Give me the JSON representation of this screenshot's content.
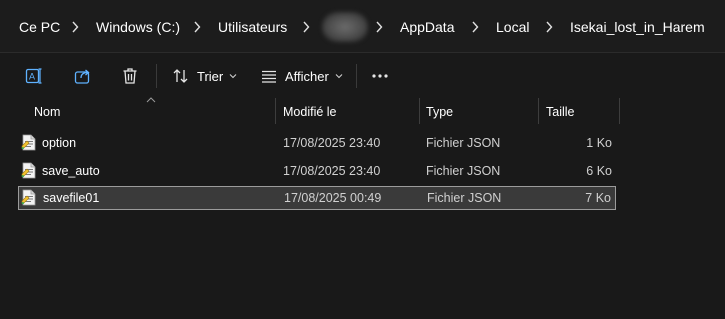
{
  "breadcrumb": {
    "items": [
      "Ce PC",
      "Windows (C:)",
      "Utilisateurs",
      "AppData",
      "Local",
      "Isekai_lost_in_Harem"
    ],
    "hidden_item_note": ""
  },
  "toolbar": {
    "rename_icon": "rename-icon",
    "share_icon": "share-icon",
    "delete_icon": "delete-icon",
    "sort_label": "Trier",
    "view_label": "Afficher",
    "more_icon": "more-icon"
  },
  "columns": {
    "name": "Nom",
    "modified": "Modifié le",
    "type": "Type",
    "size": "Taille"
  },
  "files": [
    {
      "name": "option",
      "modified": "17/08/2025 23:40",
      "type": "Fichier JSON",
      "size": "1 Ko",
      "selected": false
    },
    {
      "name": "save_auto",
      "modified": "17/08/2025 23:40",
      "type": "Fichier JSON",
      "size": "6 Ko",
      "selected": false
    },
    {
      "name": "savefile01",
      "modified": "17/08/2025 00:49",
      "type": "Fichier JSON",
      "size": "7 Ko",
      "selected": true
    }
  ],
  "colors": {
    "background": "#191919",
    "selected_row": "#3a3a3a",
    "accent": "#4cc2ff"
  }
}
